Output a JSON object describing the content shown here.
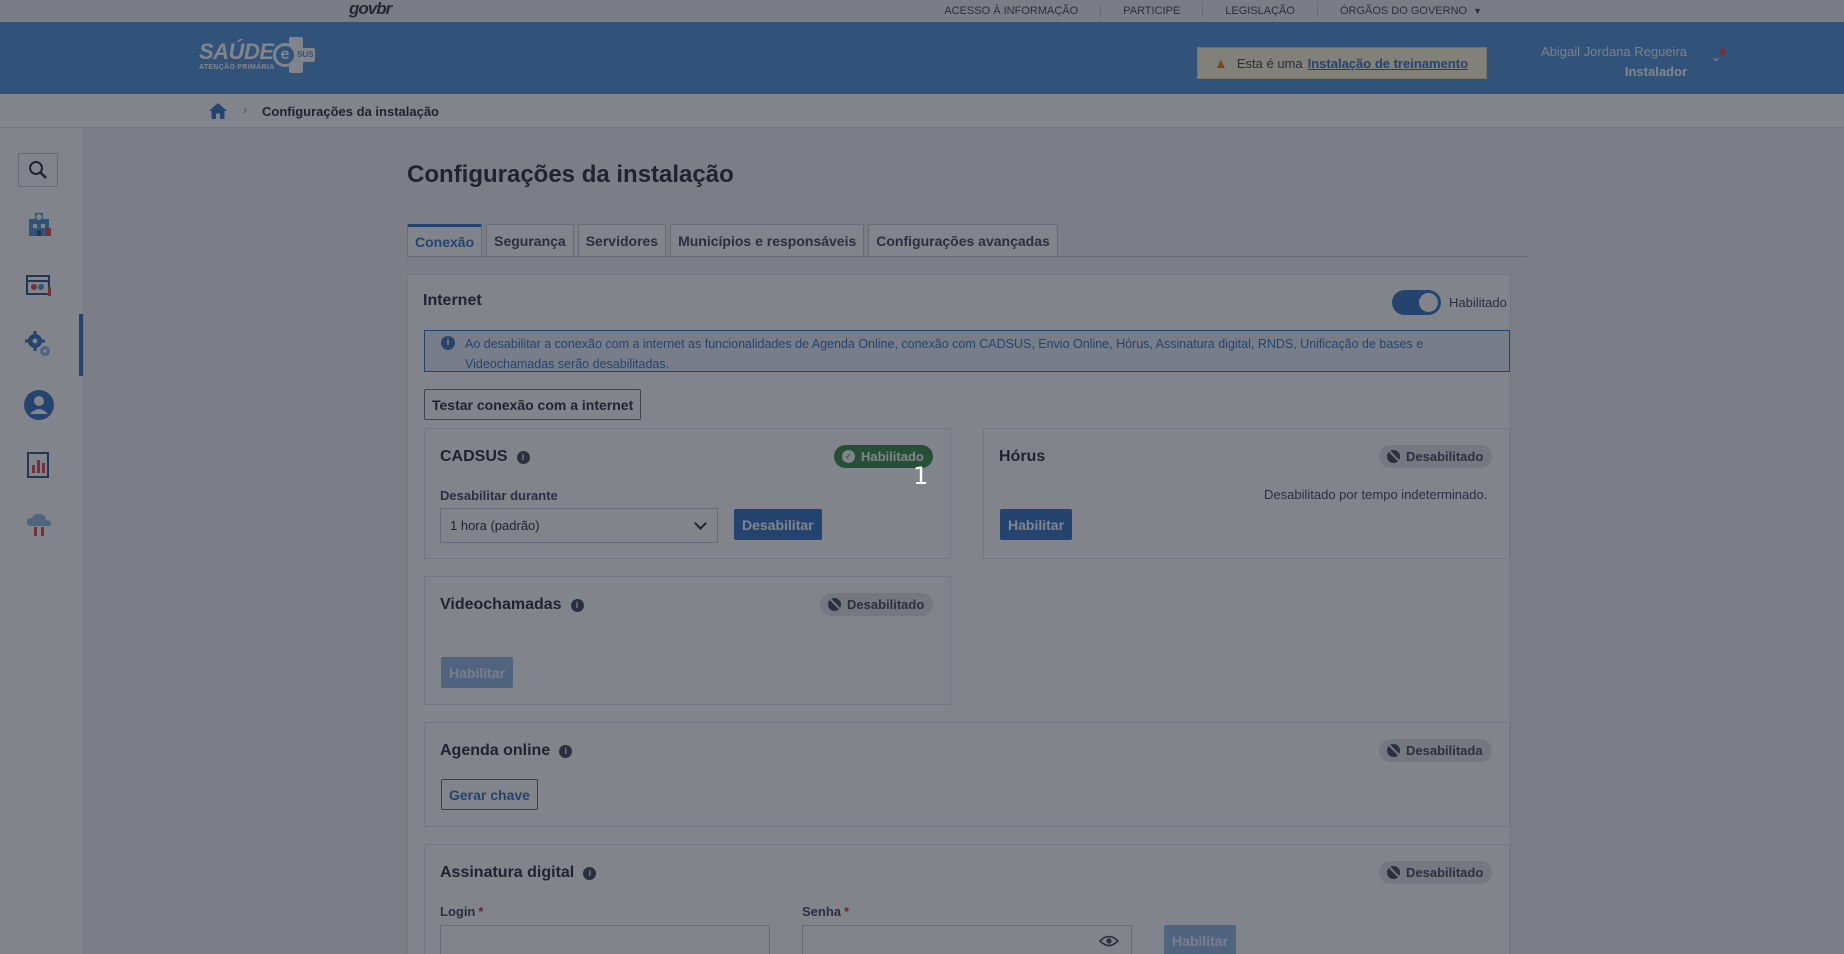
{
  "govbar": {
    "logo": "govbr",
    "links": [
      "ACESSO À INFORMAÇÃO",
      "PARTICIPE",
      "LEGISLAÇÃO",
      "ÓRGÃOS DO GOVERNO"
    ]
  },
  "header": {
    "brand_title": "SAÚDE",
    "brand_sub": "ATENÇÃO PRIMÁRIA",
    "brand_e": "e",
    "brand_sus": "SUS",
    "training_prefix": "Esta é uma",
    "training_link": "Instalação de treinamento",
    "user_name": "Abigail Jordana Regueira",
    "user_role": "Instalador"
  },
  "breadcrumb": {
    "current": "Configurações da instalação"
  },
  "sidebar": {
    "items": [
      "search-icon",
      "unit-icon",
      "schedule-icon",
      "settings-icon",
      "user-icon",
      "reports-icon",
      "cloud-sync-icon"
    ]
  },
  "page": {
    "title": "Configurações da instalação",
    "tabs": [
      "Conexão",
      "Segurança",
      "Servidores",
      "Municípios e responsáveis",
      "Configurações avançadas"
    ],
    "active_tab": "Conexão"
  },
  "internet": {
    "title": "Internet",
    "toggle_label": "Habilitado",
    "info": "Ao desabilitar a conexão com a internet as funcionalidades de Agenda Online, conexão com CADSUS, Envio Online, Hórus, Assinatura digital, RNDS, Unificação de bases e Videochamadas serão desabilitadas.",
    "test_button": "Testar conexão com a internet"
  },
  "cadsus": {
    "title": "CADSUS",
    "status": "Habilitado",
    "disable_label": "Desabilitar durante",
    "select_value": "1 hora (padrão)",
    "button": "Desabilitar"
  },
  "horus": {
    "title": "Hórus",
    "status": "Desabilitado",
    "note": "Desabilitado por tempo indeterminado.",
    "button": "Habilitar"
  },
  "videochamadas": {
    "title": "Videochamadas",
    "status": "Desabilitado",
    "button": "Habilitar"
  },
  "agenda": {
    "title": "Agenda online",
    "status": "Desabilitada",
    "button": "Gerar chave"
  },
  "assinatura": {
    "title": "Assinatura digital",
    "status": "Desabilitado",
    "login_label": "Login",
    "senha_label": "Senha",
    "required_mark": "*",
    "button": "Habilitar"
  },
  "marker": "1",
  "colors": {
    "primary": "#2c6fbf",
    "header": "#4d8fd6",
    "enabled_badge": "#2f8a3e",
    "overlay": "rgba(30,36,48,0.56)"
  }
}
